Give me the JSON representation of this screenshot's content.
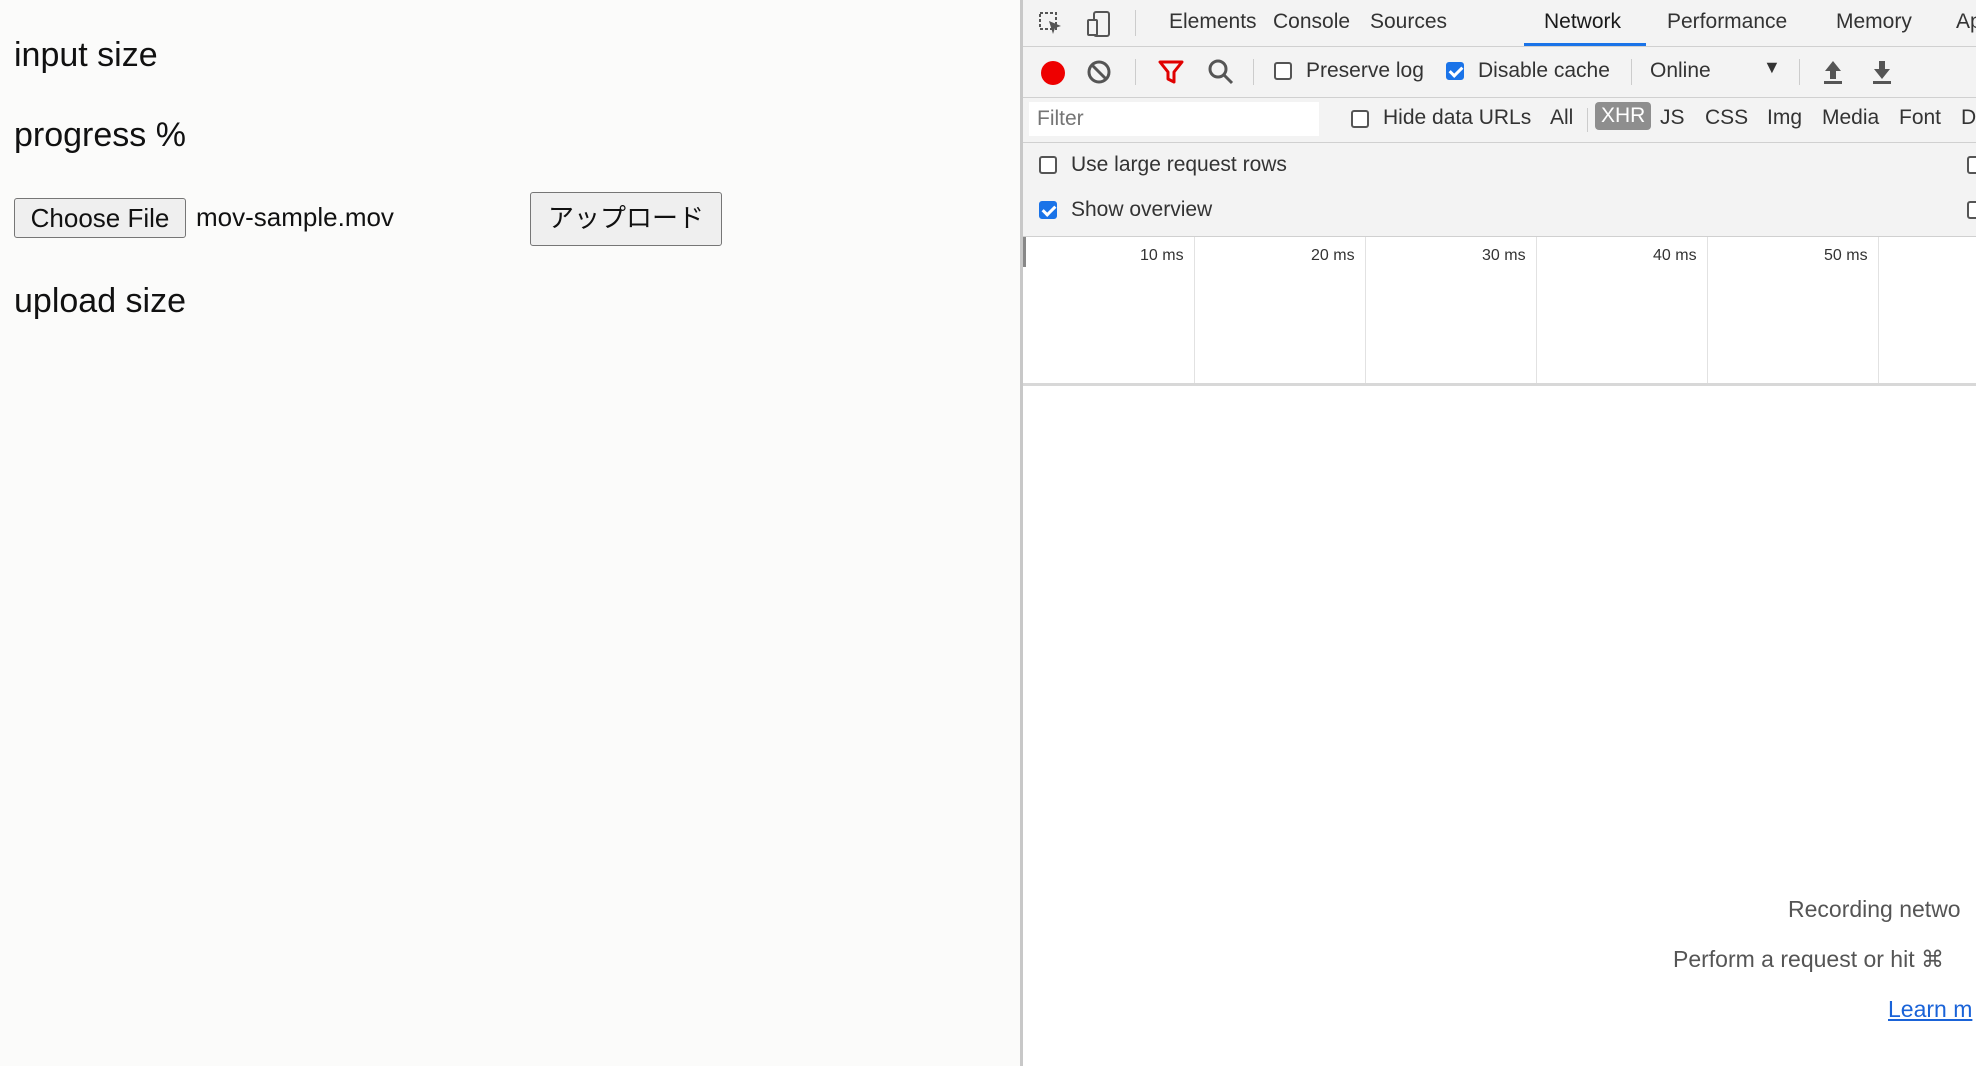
{
  "page": {
    "input_size_label": "input size",
    "progress_label": "progress %",
    "choose_file_button": "Choose File",
    "file_name": "mov-sample.mov",
    "upload_button": "アップロード",
    "upload_size_label": "upload size"
  },
  "devtools": {
    "tabs": [
      "Elements",
      "Console",
      "Sources",
      "Network",
      "Performance",
      "Memory",
      "Ap"
    ],
    "active_tab": "Network",
    "toolbar": {
      "preserve_log_label": "Preserve log",
      "preserve_log_checked": false,
      "disable_cache_label": "Disable cache",
      "disable_cache_checked": true,
      "throttling_value": "Online",
      "recording": true
    },
    "filter": {
      "placeholder": "Filter",
      "hide_data_urls_label": "Hide data URLs",
      "types": [
        "All",
        "XHR",
        "JS",
        "CSS",
        "Img",
        "Media",
        "Font",
        "Do"
      ],
      "selected_type": "XHR"
    },
    "settings": {
      "large_rows_label": "Use large request rows",
      "large_rows_checked": false,
      "show_overview_label": "Show overview",
      "show_overview_checked": true
    },
    "overview": {
      "ticks": [
        "10 ms",
        "20 ms",
        "30 ms",
        "40 ms",
        "50 ms"
      ]
    },
    "empty_state": {
      "line1": "Recording netwo",
      "line2": "Perform a request or hit ⌘",
      "link": "Learn m"
    }
  },
  "colors": {
    "accent": "#1a73e8",
    "record": "#ee0000",
    "filter_icon": "#e00000"
  }
}
